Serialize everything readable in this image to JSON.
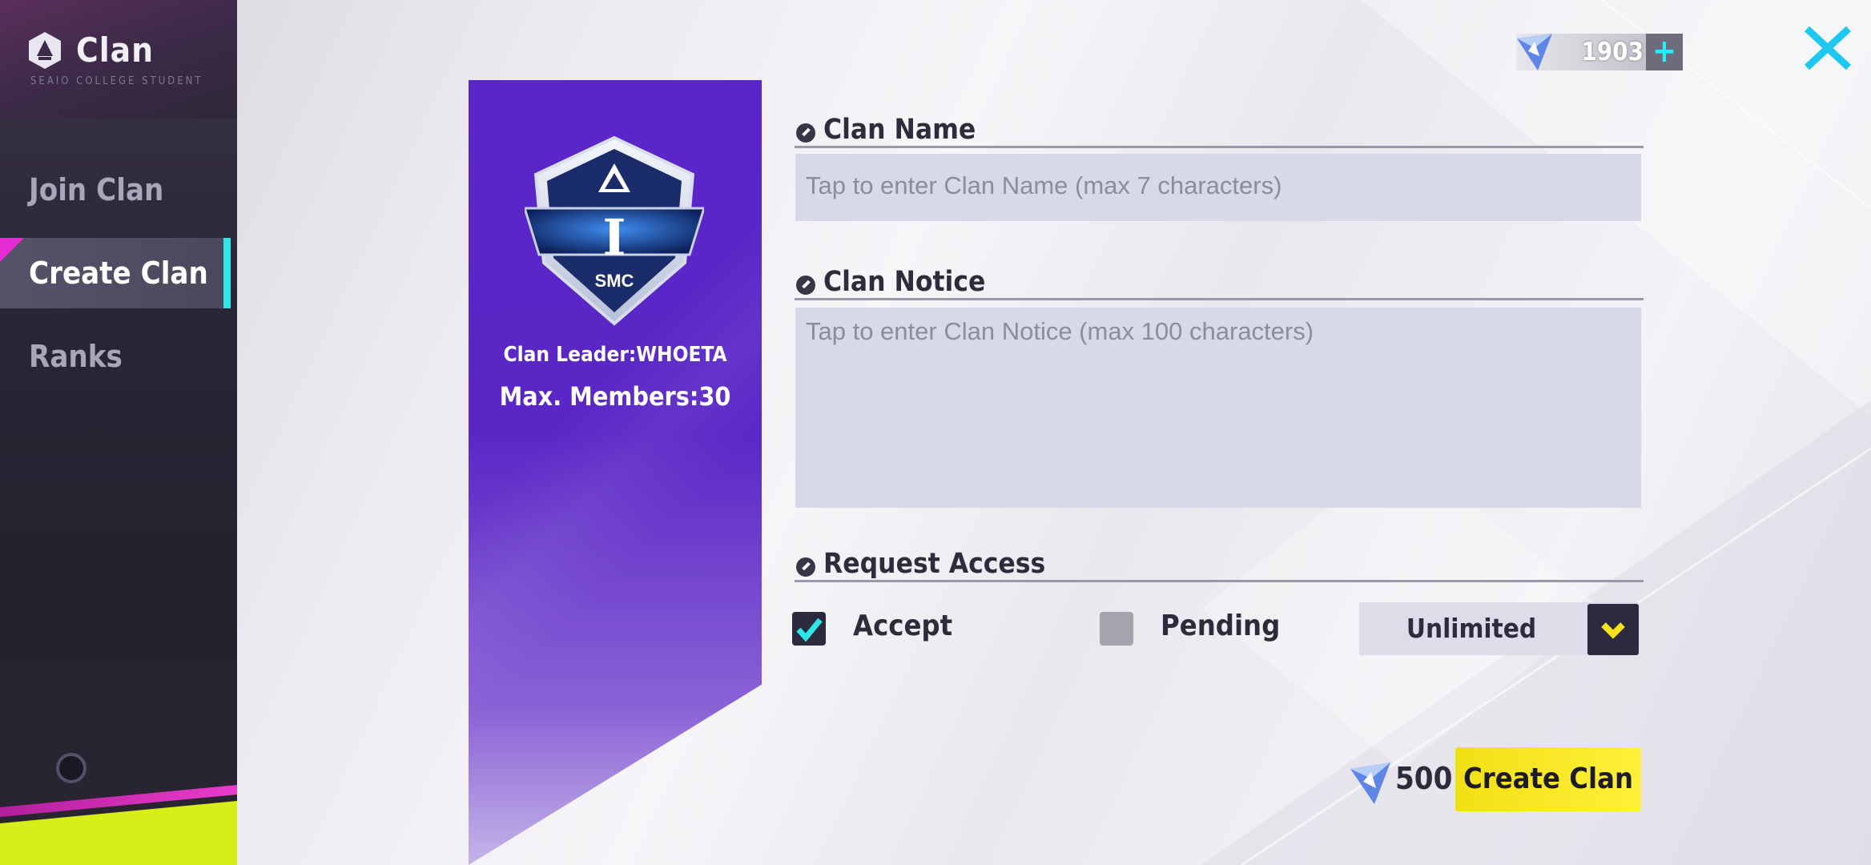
{
  "sidebar": {
    "title": "Clan",
    "subtitle": "SEAIO COLLEGE STUDENT",
    "items": [
      {
        "label": "Join Clan"
      },
      {
        "label": "Create Clan"
      },
      {
        "label": "Ranks"
      }
    ]
  },
  "banner": {
    "emblem_letter": "I",
    "emblem_tag": "SMC",
    "leader": "Clan Leader:WHOETA",
    "members": "Max. Members:30"
  },
  "form": {
    "clan_name": {
      "label": "Clan Name",
      "placeholder": "Tap to enter Clan Name (max 7 characters)",
      "value": ""
    },
    "clan_notice": {
      "label": "Clan Notice",
      "placeholder": "Tap to enter Clan Notice (max 100 characters)",
      "value": ""
    },
    "request_access": {
      "label": "Request Access",
      "accept": {
        "label": "Accept",
        "checked": true
      },
      "pending": {
        "label": "Pending",
        "checked": false
      },
      "limit": {
        "selected": "Unlimited"
      }
    }
  },
  "currency": {
    "amount": "1903",
    "plus": "+"
  },
  "create": {
    "cost": "500",
    "label": "Create Clan"
  },
  "colors": {
    "accent_cyan": "#2ee6e6",
    "banner_purple": "#5a26c8",
    "button_yellow": "#f2e015",
    "magenta": "#e52bd4"
  },
  "icons": [
    "clan-logo-icon",
    "close-icon",
    "gem-icon",
    "check-icon",
    "chevron-down-icon",
    "pencil-dot-icon"
  ]
}
